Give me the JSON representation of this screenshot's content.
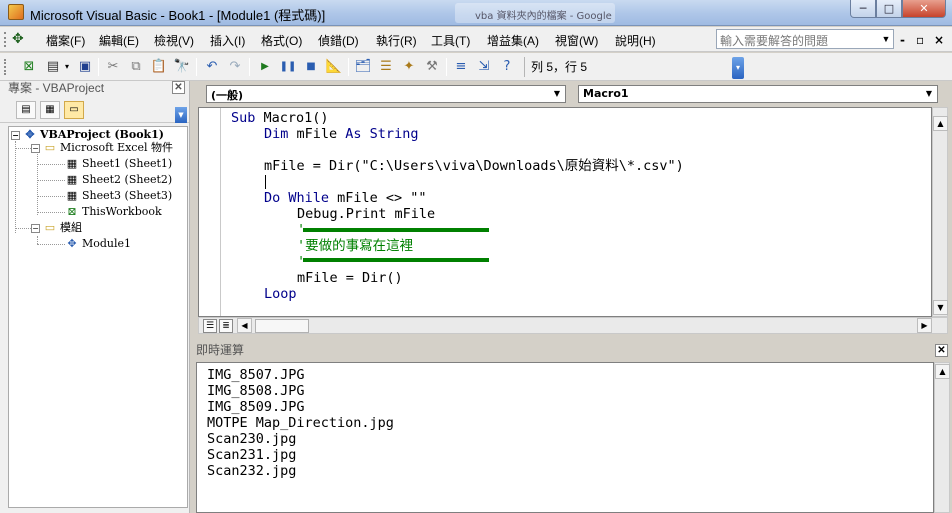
{
  "window": {
    "title": "Microsoft Visual Basic - Book1 - [Module1 (程式碼)]",
    "background_tab": "vba 資料夾內的檔案 - Google 搜尋",
    "controls": {
      "minimize": "─",
      "maximize": "□",
      "close": "✕"
    }
  },
  "menubar": {
    "items": [
      "檔案(F)",
      "編輯(E)",
      "檢視(V)",
      "插入(I)",
      "格式(O)",
      "偵錯(D)",
      "執行(R)",
      "工具(T)",
      "增益集(A)",
      "視窗(W)",
      "說明(H)"
    ],
    "ask_placeholder": "輸入需要解答的問題",
    "mdi_controls": {
      "minimize": "-",
      "restore": "▫",
      "close": "×"
    }
  },
  "toolbar": {
    "icons": [
      "excel-icon",
      "insert-icon",
      "save-icon",
      "cut-icon",
      "copy-icon",
      "paste-icon",
      "find-icon",
      "undo-icon",
      "redo-icon",
      "run-icon",
      "break-icon",
      "reset-icon",
      "design-mode-icon",
      "project-explorer-icon",
      "properties-icon",
      "object-browser-icon",
      "toolbox-icon",
      "tab-order-icon",
      "bookmark-icon",
      "help-icon"
    ],
    "cursor_position": "列 5，行 5"
  },
  "project_explorer": {
    "title": "專案 - VBAProject",
    "tree": [
      {
        "label": "VBAProject (Book1)",
        "icon": "vbaproject-icon",
        "expander": "−",
        "bold": true
      },
      {
        "label": "Microsoft Excel 物件",
        "icon": "folder-icon",
        "expander": "−"
      },
      {
        "label": "Sheet1 (Sheet1)",
        "icon": "sheet-icon"
      },
      {
        "label": "Sheet2 (Sheet2)",
        "icon": "sheet-icon"
      },
      {
        "label": "Sheet3 (Sheet3)",
        "icon": "sheet-icon"
      },
      {
        "label": "ThisWorkbook",
        "icon": "workbook-icon"
      },
      {
        "label": "模組",
        "icon": "folder-icon",
        "expander": "−"
      },
      {
        "label": "Module1",
        "icon": "module-icon"
      }
    ]
  },
  "code_window": {
    "object_combo": "(一般)",
    "procedure_combo": "Macro1",
    "lines": [
      {
        "kw": "Sub ",
        "text": "Macro1()",
        "cm": ""
      },
      {
        "kw": "Dim ",
        "text": "mFile ",
        "kw2": "As String",
        "cm": ""
      },
      {
        "kw": "",
        "text": "mFile = Dir(\"C:\\Users\\viva\\Downloads\\原始資料\\*.csv\")",
        "cm": ""
      },
      {
        "kw": "Do While ",
        "text": "mFile <> \"\"",
        "cm": ""
      },
      {
        "kw": "",
        "text": "Debug.Print mFile",
        "cm": ""
      },
      {
        "kw": "",
        "text": "",
        "cm": "'"
      },
      {
        "kw": "",
        "text": "",
        "cm": "'要做的事寫在這裡"
      },
      {
        "kw": "",
        "text": "",
        "cm": "'"
      },
      {
        "kw": "",
        "text": "mFile = Dir()",
        "cm": ""
      },
      {
        "kw": "Loop",
        "text": "",
        "cm": ""
      }
    ]
  },
  "immediate_window": {
    "title": "即時運算",
    "lines": [
      "IMG_8507.JPG",
      "IMG_8508.JPG",
      "IMG_8509.JPG",
      "MOTPE Map_Direction.jpg",
      "Scan230.jpg",
      "Scan231.jpg",
      "Scan232.jpg"
    ]
  },
  "colors": {
    "keyword": "#00008b",
    "comment": "#008000"
  }
}
